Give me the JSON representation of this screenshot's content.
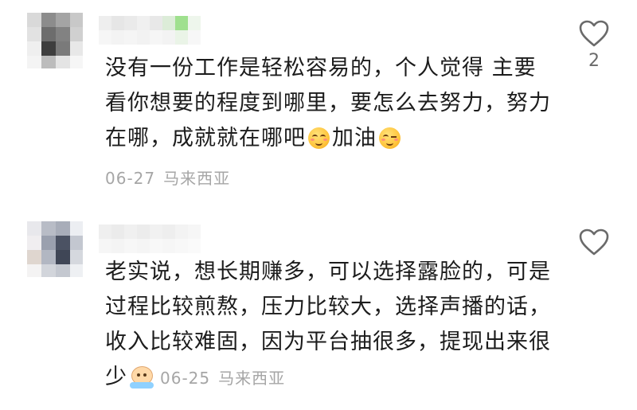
{
  "comments": [
    {
      "text_before_emoji1": "没有一份工作是轻松容易的，个人觉得 主要看你想要的程度到哪里，要怎么去努力，努力在哪，成就就在哪吧",
      "emoji1": "smiling-face-emoji",
      "text_between": "加油",
      "emoji2": "winking-face-emoji",
      "date": "06-27",
      "location": "马来西亚",
      "like_count": "2",
      "liked": false
    },
    {
      "text": "老实说，想长期赚多，可以选择露脸的，可是过程比较煎熬，压力比较大，选择声播的话，收入比较难固，因为平台抽很多，提现出来很少",
      "emoji": "crying-face-emoji",
      "date": "06-25",
      "location": "马来西亚",
      "like_count": "",
      "liked": false
    }
  ],
  "colors": {
    "text": "#1c1c1c",
    "meta": "#a6a6a6",
    "icon": "#6a6a6a"
  }
}
